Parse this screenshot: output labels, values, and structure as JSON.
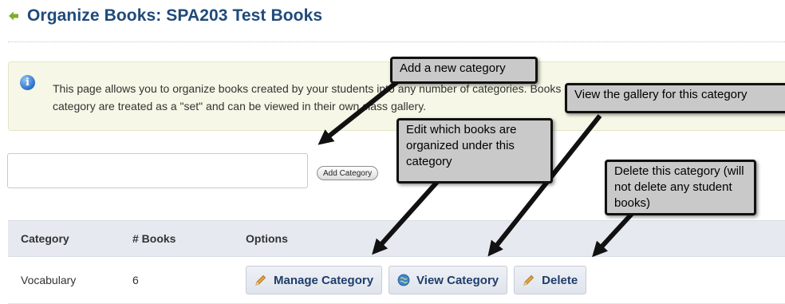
{
  "header": {
    "title": "Organize Books: SPA203 Test Books"
  },
  "info": {
    "line1": "This page allows you to organize books created by your students into any number of categories. Books organized within a",
    "line2": "category are treated as a \"set\" and can be viewed in their own class gallery."
  },
  "add_form": {
    "input_value": "",
    "button_label": "Add Category"
  },
  "table": {
    "headers": {
      "category": "Category",
      "books": "# Books",
      "options": "Options"
    },
    "rows": [
      {
        "category": "Vocabulary",
        "books": "6",
        "manage_label": "Manage Category",
        "view_label": "View Category",
        "delete_label": "Delete"
      }
    ]
  },
  "callouts": {
    "add": "Add a new category",
    "view": "View the gallery for this category",
    "edit": "Edit which books are organized under this category",
    "delete": "Delete this category (will not delete any student books)"
  },
  "colors": {
    "title": "#1f4a7a",
    "info_bg": "#f6f7e6",
    "table_header_bg": "#e6eaf0",
    "button_text": "#1f3d6b",
    "callout_bg": "#c9c9c9"
  }
}
